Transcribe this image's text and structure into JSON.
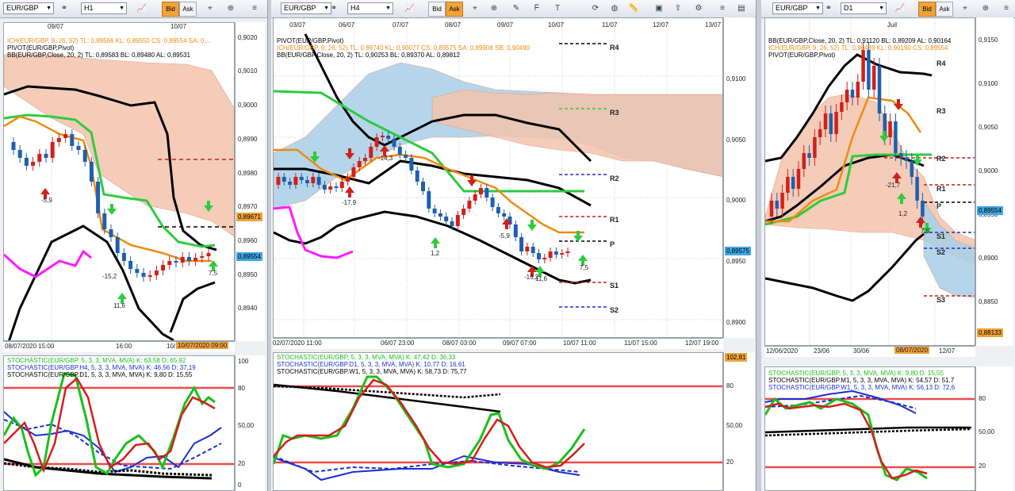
{
  "colors": {
    "bull": "#1f5fae",
    "bear": "#d0201c",
    "ich_kijun": "#2ecb3f",
    "ich_tenkan": "#f08a12",
    "bb": "#000000",
    "pivot_r": "#c8201c",
    "pivot_s": "#1a2fd0",
    "stoch_k": "#19c019",
    "stoch_d": "#d81c1c",
    "level": "#ee4a4a",
    "magenta": "#ff1aff",
    "cloud_up": "#a8cfe6",
    "cloud_dn": "#f2c3ac"
  },
  "windows": [
    {
      "symbol": "EUR/GBP",
      "timeframe": "H1",
      "bid_label": "Bid",
      "ask_label": "Ask",
      "active": "bid",
      "top_dates": [
        "09/07",
        "10/07"
      ],
      "legend": [
        {
          "text": "ICH(EUR/GBP, 9, 26, 52)   TL: 0,89566   KL: 0,89550   CS: 0,89554   SA: 0,...",
          "color": "#f08a12"
        },
        {
          "text": "PIVOT(EUR/GBP,Pivot)",
          "color": "#000000"
        },
        {
          "text": "BB(EUR/GBP,Close, 20, 2)   TL: 0,89583   BL: 0,89480   AL: 0,89531",
          "color": "#000000"
        }
      ],
      "y_ticks": [
        "0,9020",
        "0,9010",
        "0,9000",
        "0,8990",
        "0,8980",
        "0,8970",
        "0,8960",
        "0,8950",
        "0,8940"
      ],
      "price_tags": [
        {
          "text": "0,89671",
          "bg": "#f0a33a"
        },
        {
          "text": "0,89554",
          "bg": "#3fa7e3"
        }
      ],
      "x_labels": [
        "08/07/2020 15:00",
        "16:00",
        "10/"
      ],
      "x_time_tag": "10/07/2020 09:00",
      "delta_labels": [
        "-5,9",
        "-15,2",
        "11,6",
        "7,5"
      ],
      "stoch_legend": [
        {
          "text": "STOCHASTIC(EUR/GBP, 5, 3, 3, MVA, MVA)   K: 63,58   D: 65,92",
          "color": "#19c019"
        },
        {
          "text": "STOCHASTIC(EUR/GBP.H4, 5, 3, 3, MVA, MVA)   K: 46,56   D: 37,19",
          "color": "#1a2fd0"
        },
        {
          "text": "STOCHASTIC(EUR/GBP.D1, 5, 3, 3, MVA, MVA)   K: 9,80   D: 15,55",
          "color": "#000000"
        }
      ],
      "stoch_ticks": [
        "100",
        "80",
        "50,00",
        "20",
        "0"
      ]
    },
    {
      "symbol": "EUR/GBP",
      "timeframe": "H4",
      "bid_label": "Bid",
      "ask_label": "Ask",
      "active": "ask",
      "top_dates": [
        "03/07",
        "06/07",
        "07/07",
        "08/07",
        "09/07",
        "10/07",
        "11/07",
        "12/07",
        "13/07"
      ],
      "legend": [
        {
          "text": "PIVOT(EUR/GBP,Pivot)",
          "color": "#000000"
        },
        {
          "text": "ICH(EUR/GBP, 9, 26, 52)   TL: 0,89740   KL: 0,90077   CS: 0,89575   SA: 0,89908   SB: 0,90490",
          "color": "#f08a12"
        },
        {
          "text": "BB(EUR/GBP,Close, 20, 2)   TL: 0,90253   BL: 0,89370   AL: 0,89812",
          "color": "#000000"
        }
      ],
      "y_ticks": [
        "0,9100",
        "0,9050",
        "0,9000",
        "0,8950",
        "0,8900"
      ],
      "price_tags": [
        {
          "text": "0,89575",
          "bg": "#3fa7e3"
        }
      ],
      "pivot_labels": [
        "R4",
        "R3",
        "R2",
        "R1",
        "P",
        "S1",
        "S2"
      ],
      "x_labels": [
        "02/07/2020 11:00",
        "06/07 23:00",
        "08/07 03:00",
        "09/07 07:00",
        "10/07 11:00",
        "11/07 15:00",
        "12/07 19:00"
      ],
      "delta_labels": [
        "-17,9",
        "-14,3",
        "1,2",
        "-5,9",
        "-15,2",
        "11,6",
        "7,5"
      ],
      "stoch_legend": [
        {
          "text": "STOCHASTIC(EUR/GBP, 5, 3, 3, MVA, MVA)   K: 47,42   D: 36,33",
          "color": "#19c019"
        },
        {
          "text": "STOCHASTIC(EUR/GBP.D1, 5, 3, 3, MVA, MVA)   K: 10,77   D: 16,61",
          "color": "#1a2fd0"
        },
        {
          "text": "STOCHASTIC(EUR/GBP.W1, 5, 3, 3, MVA, MVA)   K: 58,73   D: 75,77",
          "color": "#000000"
        }
      ],
      "stoch_tag": "102,81",
      "stoch_ticks": [
        "80",
        "50,00",
        "20"
      ]
    },
    {
      "symbol": "EUR/GBP",
      "timeframe": "D1",
      "bid_label": "Bid",
      "ask_label": "Ask",
      "active": "bid",
      "top_dates": [
        "Juil"
      ],
      "legend": [
        {
          "text": "BB(EUR/GBP,Close, 20, 2)   TL: 0,91120   BL: 0,89209   AL: 0,90164",
          "color": "#000000"
        },
        {
          "text": "ICH(EUR/GBP, 9, 26, 52)   TL: 0,90439   KL: 0,90190   CS: 0,89554",
          "color": "#f08a12"
        },
        {
          "text": "PIVOT(EUR/GBP,Pivot)",
          "color": "#000000"
        }
      ],
      "y_ticks": [
        "0,9150",
        "0,9100",
        "0,9050",
        "0,9000",
        "0,8950",
        "0,8900",
        "0,8850"
      ],
      "price_tags": [
        {
          "text": "0,89554",
          "bg": "#3fa7e3"
        },
        {
          "text": "0,88133",
          "bg": "#f0a33a"
        }
      ],
      "pivot_labels": [
        "R4",
        "R3",
        "R2",
        "R1",
        "P",
        "S1",
        "S2",
        "S3"
      ],
      "x_labels": [
        "12/06/2020",
        "23/06",
        "30/06",
        "12/07"
      ],
      "x_time_tag": "08/07/2020",
      "delta_labels": [
        "-21,7",
        "1,2",
        "7,5"
      ],
      "stoch_legend": [
        {
          "text": "STOCHASTIC(EUR/GBP, 5, 3, 3, MVA, MVA)   K: 9,80   D: 15,55",
          "color": "#19c019"
        },
        {
          "text": "STOCHASTIC(EUR/GBP.M1, 5, 3, 3, MVA, MVA)   K: 54,57   D: 51,7",
          "color": "#000000"
        },
        {
          "text": "STOCHASTIC(EUR/GBP.W1, 5, 3, 3, MVA, MVA)   K: 56,13   D: 72,6",
          "color": "#1a2fd0"
        }
      ],
      "stoch_ticks": [
        "80",
        "50,00",
        "20"
      ]
    }
  ]
}
